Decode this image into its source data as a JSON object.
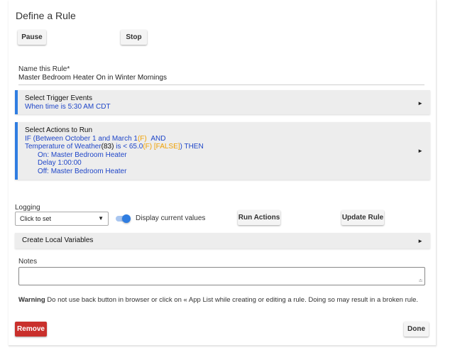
{
  "page": {
    "title": "Define a Rule"
  },
  "controls": {
    "pause_label": "Pause",
    "stop_label": "Stop"
  },
  "rule_name": {
    "label": "Name this Rule*",
    "value": "Master Bedroom Heater On in Winter Mornings"
  },
  "triggers": {
    "title": "Select Trigger Events",
    "summary": "When time is 5:30 AM CDT"
  },
  "actions": {
    "title": "Select Actions to Run",
    "line1_a": "IF (Between October 1 and March 1",
    "line1_b": "(F)",
    "line1_c": "AND",
    "line2_a": "Temperature of Weather",
    "line2_b": "(83)",
    "line2_c": " is < 65.0",
    "line2_d": "(F) [FALSE]",
    "line2_e": ") THEN",
    "items": [
      "On: Master Bedroom Heater",
      "Delay 1:00:00",
      "Off: Master Bedroom Heater"
    ]
  },
  "logging": {
    "label": "Logging",
    "select_value": "Click to set",
    "toggle_on": true,
    "display_label": "Display current values",
    "run_actions_label": "Run Actions",
    "update_rule_label": "Update Rule"
  },
  "local_variables": {
    "title": "Create Local Variables"
  },
  "notes": {
    "label": "Notes",
    "value": ""
  },
  "warning": {
    "bold": "Warning",
    "text": " Do not use back button in browser or click on « App List while creating or editing a rule. Doing so may result in a broken rule."
  },
  "footer": {
    "remove_label": "Remove",
    "done_label": "Done"
  },
  "colors": {
    "accent": "#2f7de1",
    "link_text": "#1f46c8",
    "highlight": "#f0a000",
    "danger": "#c9302c"
  }
}
